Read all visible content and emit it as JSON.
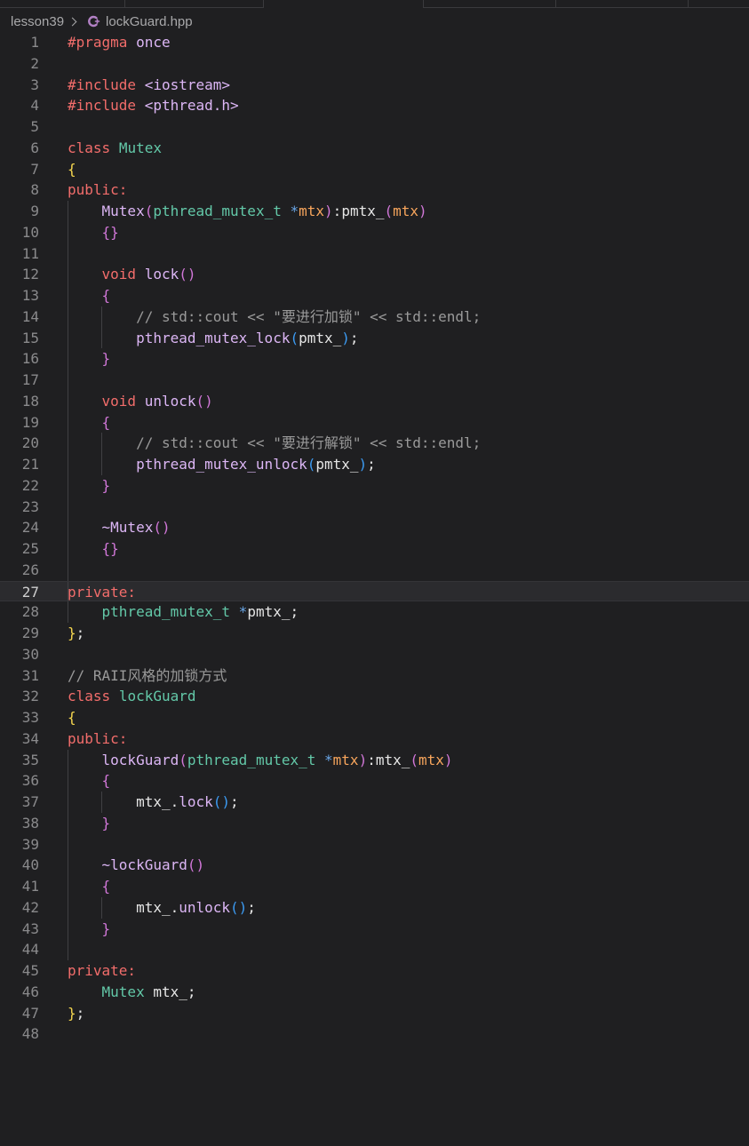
{
  "breadcrumb": {
    "folder": "lesson39",
    "file": "lockGuard.hpp",
    "file_icon": "cpp-file-icon"
  },
  "colors": {
    "background": "#1f1f21",
    "keyword": "#f26d6b",
    "type": "#63c8a8",
    "function": "#dcb6f5",
    "comment": "#9a9a9a",
    "bracket_level1": "#f5d64f",
    "bracket_level2": "#d177d8",
    "bracket_level3": "#3c9bf3",
    "parameter": "#f7a55c"
  },
  "active_line": 27,
  "lines": [
    {
      "n": "1",
      "t": [
        [
          "pp",
          "#pragma"
        ],
        [
          "id",
          " "
        ],
        [
          "fn",
          "once"
        ]
      ]
    },
    {
      "n": "2",
      "t": []
    },
    {
      "n": "3",
      "t": [
        [
          "pp",
          "#include"
        ],
        [
          "id",
          " "
        ],
        [
          "fn",
          "<iostream>"
        ]
      ]
    },
    {
      "n": "4",
      "t": [
        [
          "pp",
          "#include"
        ],
        [
          "id",
          " "
        ],
        [
          "fn",
          "<pthread.h>"
        ]
      ]
    },
    {
      "n": "5",
      "t": []
    },
    {
      "n": "6",
      "t": [
        [
          "kw",
          "class"
        ],
        [
          "id",
          " "
        ],
        [
          "ty",
          "Mutex"
        ]
      ]
    },
    {
      "n": "7",
      "t": [
        [
          "b1",
          "{"
        ]
      ]
    },
    {
      "n": "8",
      "t": [
        [
          "kw",
          "public:"
        ]
      ]
    },
    {
      "n": "9",
      "t": [
        [
          "id",
          "    "
        ],
        [
          "fn",
          "Mutex"
        ],
        [
          "b2",
          "("
        ],
        [
          "ty",
          "pthread_mutex_t"
        ],
        [
          "id",
          " "
        ],
        [
          "op",
          "*"
        ],
        [
          "pa",
          "mtx"
        ],
        [
          "b2",
          ")"
        ],
        [
          "pu",
          ":"
        ],
        [
          "id",
          "pmtx_"
        ],
        [
          "b2",
          "("
        ],
        [
          "pa",
          "mtx"
        ],
        [
          "b2",
          ")"
        ]
      ]
    },
    {
      "n": "10",
      "t": [
        [
          "id",
          "    "
        ],
        [
          "b2",
          "{}"
        ]
      ]
    },
    {
      "n": "11",
      "t": []
    },
    {
      "n": "12",
      "t": [
        [
          "id",
          "    "
        ],
        [
          "kw",
          "void"
        ],
        [
          "id",
          " "
        ],
        [
          "fn",
          "lock"
        ],
        [
          "b2",
          "()"
        ]
      ]
    },
    {
      "n": "13",
      "t": [
        [
          "id",
          "    "
        ],
        [
          "b2",
          "{"
        ]
      ]
    },
    {
      "n": "14",
      "t": [
        [
          "id",
          "        "
        ],
        [
          "cm",
          "// std::cout << \"要进行加锁\" << std::endl;"
        ]
      ]
    },
    {
      "n": "15",
      "t": [
        [
          "id",
          "        "
        ],
        [
          "fn",
          "pthread_mutex_lock"
        ],
        [
          "b3",
          "("
        ],
        [
          "id",
          "pmtx_"
        ],
        [
          "b3",
          ")"
        ],
        [
          "pu",
          ";"
        ]
      ]
    },
    {
      "n": "16",
      "t": [
        [
          "id",
          "    "
        ],
        [
          "b2",
          "}"
        ]
      ]
    },
    {
      "n": "17",
      "t": []
    },
    {
      "n": "18",
      "t": [
        [
          "id",
          "    "
        ],
        [
          "kw",
          "void"
        ],
        [
          "id",
          " "
        ],
        [
          "fn",
          "unlock"
        ],
        [
          "b2",
          "()"
        ]
      ]
    },
    {
      "n": "19",
      "t": [
        [
          "id",
          "    "
        ],
        [
          "b2",
          "{"
        ]
      ]
    },
    {
      "n": "20",
      "t": [
        [
          "id",
          "        "
        ],
        [
          "cm",
          "// std::cout << \"要进行解锁\" << std::endl;"
        ]
      ]
    },
    {
      "n": "21",
      "t": [
        [
          "id",
          "        "
        ],
        [
          "fn",
          "pthread_mutex_unlock"
        ],
        [
          "b3",
          "("
        ],
        [
          "id",
          "pmtx_"
        ],
        [
          "b3",
          ")"
        ],
        [
          "pu",
          ";"
        ]
      ]
    },
    {
      "n": "22",
      "t": [
        [
          "id",
          "    "
        ],
        [
          "b2",
          "}"
        ]
      ]
    },
    {
      "n": "23",
      "t": []
    },
    {
      "n": "24",
      "t": [
        [
          "id",
          "    "
        ],
        [
          "fn",
          "~Mutex"
        ],
        [
          "b2",
          "()"
        ]
      ]
    },
    {
      "n": "25",
      "t": [
        [
          "id",
          "    "
        ],
        [
          "b2",
          "{}"
        ]
      ]
    },
    {
      "n": "26",
      "t": []
    },
    {
      "n": "27",
      "t": [
        [
          "kw",
          "private:"
        ]
      ]
    },
    {
      "n": "28",
      "t": [
        [
          "id",
          "    "
        ],
        [
          "ty",
          "pthread_mutex_t"
        ],
        [
          "id",
          " "
        ],
        [
          "op",
          "*"
        ],
        [
          "id",
          "pmtx_"
        ],
        [
          "pu",
          ";"
        ]
      ]
    },
    {
      "n": "29",
      "t": [
        [
          "b1",
          "}"
        ],
        [
          "pu",
          ";"
        ]
      ]
    },
    {
      "n": "30",
      "t": []
    },
    {
      "n": "31",
      "t": [
        [
          "cm",
          "// RAII风格的加锁方式"
        ]
      ]
    },
    {
      "n": "32",
      "t": [
        [
          "kw",
          "class"
        ],
        [
          "id",
          " "
        ],
        [
          "ty",
          "lockGuard"
        ]
      ]
    },
    {
      "n": "33",
      "t": [
        [
          "b1",
          "{"
        ]
      ]
    },
    {
      "n": "34",
      "t": [
        [
          "kw",
          "public:"
        ]
      ]
    },
    {
      "n": "35",
      "t": [
        [
          "id",
          "    "
        ],
        [
          "fn",
          "lockGuard"
        ],
        [
          "b2",
          "("
        ],
        [
          "ty",
          "pthread_mutex_t"
        ],
        [
          "id",
          " "
        ],
        [
          "op",
          "*"
        ],
        [
          "pa",
          "mtx"
        ],
        [
          "b2",
          ")"
        ],
        [
          "pu",
          ":"
        ],
        [
          "id",
          "mtx_"
        ],
        [
          "b2",
          "("
        ],
        [
          "pa",
          "mtx"
        ],
        [
          "b2",
          ")"
        ]
      ]
    },
    {
      "n": "36",
      "t": [
        [
          "id",
          "    "
        ],
        [
          "b2",
          "{"
        ]
      ]
    },
    {
      "n": "37",
      "t": [
        [
          "id",
          "        "
        ],
        [
          "id",
          "mtx_."
        ],
        [
          "fn",
          "lock"
        ],
        [
          "b3",
          "()"
        ],
        [
          "pu",
          ";"
        ]
      ]
    },
    {
      "n": "38",
      "t": [
        [
          "id",
          "    "
        ],
        [
          "b2",
          "}"
        ]
      ]
    },
    {
      "n": "39",
      "t": []
    },
    {
      "n": "40",
      "t": [
        [
          "id",
          "    "
        ],
        [
          "fn",
          "~lockGuard"
        ],
        [
          "b2",
          "()"
        ]
      ]
    },
    {
      "n": "41",
      "t": [
        [
          "id",
          "    "
        ],
        [
          "b2",
          "{"
        ]
      ]
    },
    {
      "n": "42",
      "t": [
        [
          "id",
          "        "
        ],
        [
          "id",
          "mtx_."
        ],
        [
          "fn",
          "unlock"
        ],
        [
          "b3",
          "()"
        ],
        [
          "pu",
          ";"
        ]
      ]
    },
    {
      "n": "43",
      "t": [
        [
          "id",
          "    "
        ],
        [
          "b2",
          "}"
        ]
      ]
    },
    {
      "n": "44",
      "t": []
    },
    {
      "n": "45",
      "t": [
        [
          "kw",
          "private:"
        ]
      ]
    },
    {
      "n": "46",
      "t": [
        [
          "id",
          "    "
        ],
        [
          "ty",
          "Mutex"
        ],
        [
          "id",
          " "
        ],
        [
          "id",
          "mtx_"
        ],
        [
          "pu",
          ";"
        ]
      ]
    },
    {
      "n": "47",
      "t": [
        [
          "b1",
          "}"
        ],
        [
          "pu",
          ";"
        ]
      ]
    },
    {
      "n": "48",
      "t": []
    }
  ]
}
